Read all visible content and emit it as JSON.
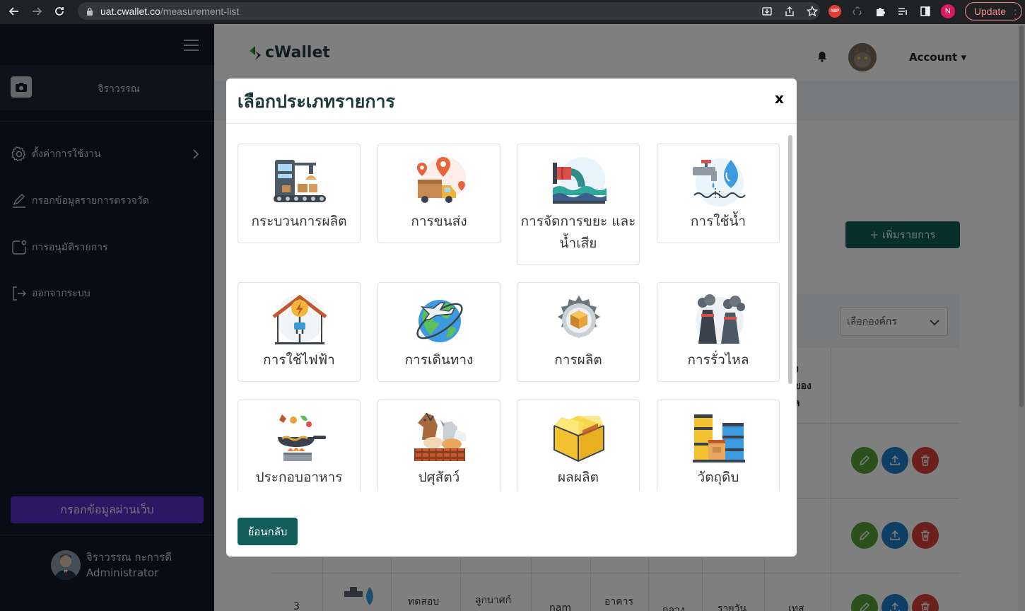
{
  "browser": {
    "url_host": "uat.cwallet.co",
    "url_path": "/measurement-list",
    "profile_initial": "N",
    "abp_label": "ABP",
    "update_label": "Update"
  },
  "sidebar": {
    "profile_name": "จิราวรรณ",
    "items": [
      {
        "label": "ตั้งค่าการใช้งาน"
      },
      {
        "label": "กรอกข้อมูลรายการตรวจวัด"
      },
      {
        "label": "การอนุมัติรายการ"
      },
      {
        "label": "ออกจากระบบ"
      }
    ],
    "web_button": "กรอกข้อมูลผ่านเว็บ",
    "user_name": "จิราวรรณ กะการดี",
    "user_role": "Administrator"
  },
  "header": {
    "logo_text": "cWallet",
    "account_label": "Account"
  },
  "page": {
    "add_button": "+ เพิ่มรายการ",
    "org_select": "เลือกองค์กร",
    "header_fragment": [
      "ง",
      "ของ",
      "ล"
    ],
    "row3": {
      "no": "3",
      "name": "ทดสอบ",
      "unit": "ลูกบาศก์",
      "c4": "nam",
      "c5": "อาคาร",
      "c6": "กลาง",
      "c7": "รายวัน",
      "c8": "เทส"
    }
  },
  "modal": {
    "title": "เลือกประเภทรายการ",
    "close_label": "x",
    "categories": [
      {
        "label": "กระบวนการผลิต",
        "icon": "factory-icon"
      },
      {
        "label": "การขนส่ง",
        "icon": "delivery-truck-icon"
      },
      {
        "label": "การจัดการขยะ และน้ำเสีย",
        "icon": "wastewater-pipe-icon"
      },
      {
        "label": "การใช้น้ำ",
        "icon": "water-tap-icon"
      },
      {
        "label": "การใช้ไฟฟ้า",
        "icon": "electric-house-icon"
      },
      {
        "label": "การเดินทาง",
        "icon": "globe-plane-icon"
      },
      {
        "label": "การผลิต",
        "icon": "gear-box-icon"
      },
      {
        "label": "การรั่วไหล",
        "icon": "smokestack-icon"
      },
      {
        "label": "ประกอบอาหาร",
        "icon": "cooking-pan-icon"
      },
      {
        "label": "ปศุสัตว์",
        "icon": "livestock-icon"
      },
      {
        "label": "ผลผลิต",
        "icon": "product-box-icon"
      },
      {
        "label": "วัตถุดิบ",
        "icon": "raw-material-barrels-icon"
      }
    ],
    "back_button": "ย้อนกลับ"
  },
  "colors": {
    "sidebar_bg": "#101a2a",
    "primary_teal": "#115e5a",
    "web_button_purple": "#5b2ec9",
    "edit_green": "#55a33a",
    "upload_blue": "#1f7fc9",
    "delete_red": "#d8403a"
  }
}
